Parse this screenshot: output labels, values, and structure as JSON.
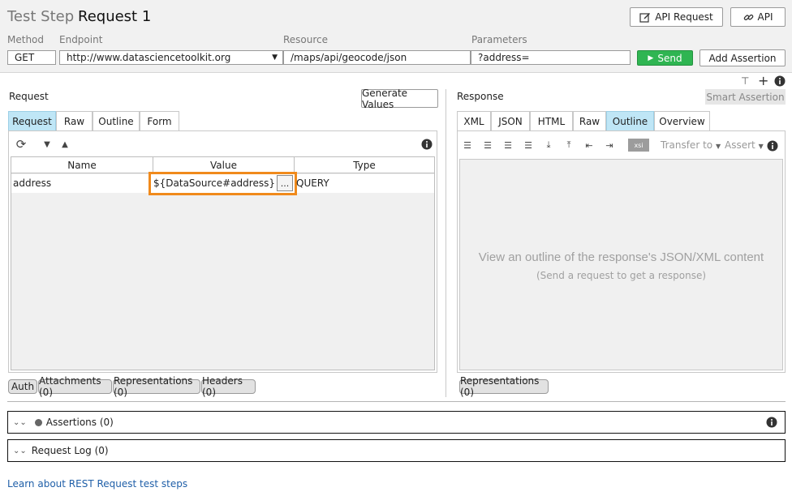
{
  "header": {
    "kind_label": "Test Step",
    "name": "Request 1",
    "api_request_btn": "API Request",
    "api_btn": "API"
  },
  "fields": {
    "method_label": "Method",
    "endpoint_label": "Endpoint",
    "resource_label": "Resource",
    "parameters_label": "Parameters",
    "method_value": "GET",
    "endpoint_value": "http://www.datasciencetoolkit.org",
    "resource_value": "/maps/api/geocode/json",
    "parameters_value": "?address="
  },
  "actions": {
    "send": "Send",
    "add_assertion": "Add Assertion"
  },
  "request": {
    "title": "Request",
    "generate_values": "Generate Values",
    "tabs": [
      {
        "label": "Request"
      },
      {
        "label": "Raw"
      },
      {
        "label": "Outline"
      },
      {
        "label": "Form"
      }
    ],
    "table": {
      "headers": [
        "Name",
        "Value",
        "Type"
      ],
      "rows": [
        {
          "name": "address",
          "value": "${DataSource#address}",
          "type": "QUERY"
        }
      ],
      "ellipsis": "..."
    },
    "bottom_tabs": [
      "Auth",
      "Attachments (0)",
      "Representations (0)",
      "Headers (0)"
    ]
  },
  "response": {
    "title": "Response",
    "smart_assertion": "Smart Assertion",
    "tabs": [
      {
        "label": "XML"
      },
      {
        "label": "JSON"
      },
      {
        "label": "HTML"
      },
      {
        "label": "Raw"
      },
      {
        "label": "Outline"
      },
      {
        "label": "Overview"
      }
    ],
    "toolbar": {
      "xsi": "xsi",
      "transfer_to": "Transfer to",
      "assert": "Assert"
    },
    "empty_title": "View an outline of the response's JSON/XML content",
    "empty_subtitle": "(Send a request to get a response)",
    "bottom_tabs": [
      "Representations (0)"
    ]
  },
  "sections": {
    "assertions": "Assertions (0)",
    "request_log": "Request Log (0)"
  },
  "footer": {
    "learn_link": "Learn about REST Request test steps"
  },
  "colors": {
    "accent_tab": "#bfe6f6",
    "send": "#2fb552",
    "highlight": "#f08a1c",
    "link": "#1f5fa8"
  }
}
